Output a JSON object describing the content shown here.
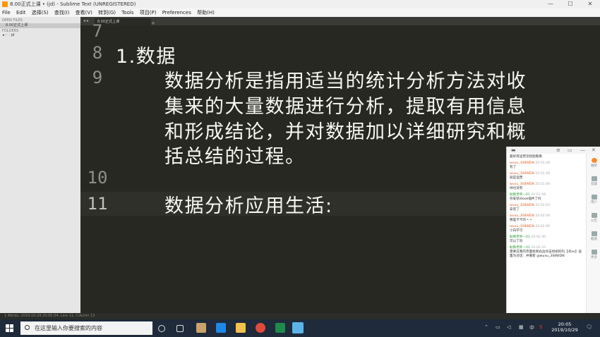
{
  "window": {
    "title": "8.00正式上课 • (jd) - Sublime Text (UNREGISTERED)",
    "controls": [
      "—",
      "☐",
      "✕"
    ]
  },
  "menu": [
    "File",
    "Edit",
    "选择(S)",
    "查找(I)",
    "查看(V)",
    "转到(G)",
    "Tools",
    "项目(P)",
    "Preferences",
    "帮助(H)"
  ],
  "sidebar": {
    "open_files_label": "OPEN FILES",
    "open_file": "8.00正式上课",
    "folders_label": "FOLDERS",
    "folder": "▸ 🗁 jd"
  },
  "tab": {
    "name": "8.00正式上课",
    "nav": "◂ ▸",
    "plus": "+"
  },
  "editor": {
    "lines": [
      {
        "num": "7",
        "text": ""
      },
      {
        "num": "8",
        "text": "1.数据"
      },
      {
        "num": "9",
        "text": "数据分析是指用适当的统计分析方法对收"
      },
      {
        "num": "",
        "text": "集来的大量数据进行分析，提取有用信息"
      },
      {
        "num": "",
        "text": "和形成结论，并对数据加以详细研究和概"
      },
      {
        "num": "",
        "text": "括总结的过程。"
      },
      {
        "num": "10",
        "text": ""
      },
      {
        "num": "11",
        "text": "数据分析应用生活:"
      }
    ]
  },
  "chat": {
    "messages": [
      {
        "name": "",
        "time": "",
        "text": "最好有运营流程图看看",
        "green": false
      },
      {
        "name": "wuxu_308WDN",
        "time": "20:01:48",
        "text": "有了",
        "green": false
      },
      {
        "name": "wuxu_308WDN",
        "time": "20:01:48",
        "text": "就是运营",
        "green": false
      },
      {
        "name": "wuxu_308WDN",
        "time": "20:01:49",
        "text": "绿也没有",
        "green": false
      },
      {
        "name": "助教老师—01",
        "time": "20:01:58",
        "text": "你安装dlook插件了吗",
        "green": true
      },
      {
        "name": "wuxu_308WDN",
        "time": "20:02:03",
        "text": "安装了",
        "green": false
      },
      {
        "name": "wuxu_308WDN",
        "time": "20:02:09",
        "text": "哪里卡卡的 • •",
        "green": false
      },
      {
        "name": "wuxu_308WDN",
        "time": "20:02:09",
        "text": "小白学习",
        "green": false
      },
      {
        "name": "助教老师—01",
        "time": "20:02:30",
        "text": "可以了吗",
        "green": true
      },
      {
        "name": "助教老师—01",
        "time": "20:02:33",
        "text": "需要在我的页面找到右边点击找组的吗【点xx】设置为对话：并重新 @wuxu_308WDN",
        "green": true
      }
    ],
    "side_buttons": [
      "抽奖",
      "答疑",
      "用户",
      "公告",
      "截图",
      "更多"
    ]
  },
  "statusbar": {
    "text": "1 Words, 2019-10-29 20:05:34, Line 11, Column 13"
  },
  "taskbar": {
    "search_placeholder": "在这里输入你要搜索的内容",
    "time": "20:05",
    "date": "2019/10/29"
  },
  "colors": {
    "editor_bg": "#272822",
    "accent": "#ff8a2a",
    "taskbar": "#1f2a3a"
  }
}
